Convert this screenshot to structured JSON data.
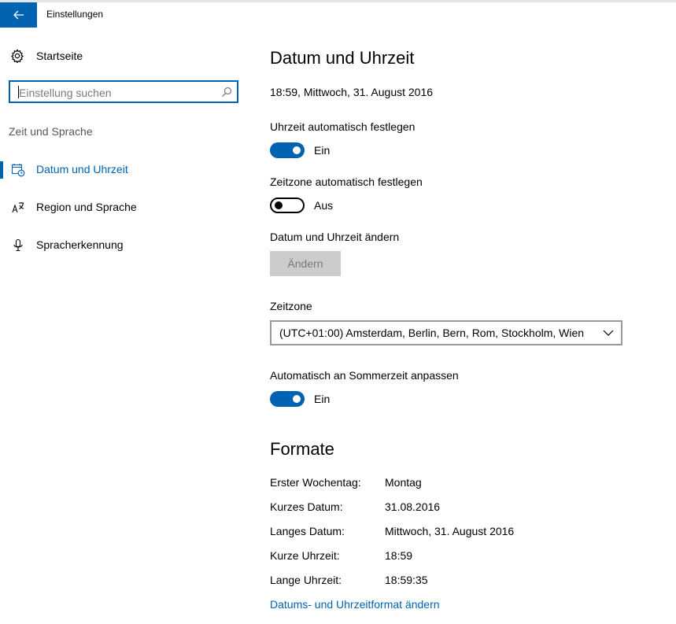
{
  "window": {
    "title": "Einstellungen"
  },
  "sidebar": {
    "home_label": "Startseite",
    "search": {
      "placeholder": "Einstellung suchen"
    },
    "section_label": "Zeit und Sprache",
    "items": [
      {
        "label": "Datum und Uhrzeit",
        "icon": "calendar-clock-icon",
        "active": true
      },
      {
        "label": "Region und Sprache",
        "icon": "language-icon",
        "active": false
      },
      {
        "label": "Spracherkennung",
        "icon": "microphone-icon",
        "active": false
      }
    ]
  },
  "main": {
    "title": "Datum und Uhrzeit",
    "current_datetime": "18:59, Mittwoch, 31. August 2016",
    "auto_time": {
      "label": "Uhrzeit automatisch festlegen",
      "state": "Ein",
      "on": true
    },
    "auto_timezone": {
      "label": "Zeitzone automatisch festlegen",
      "state": "Aus",
      "on": false
    },
    "change": {
      "label": "Datum und Uhrzeit ändern",
      "button": "Ändern"
    },
    "timezone": {
      "label": "Zeitzone",
      "value": "(UTC+01:00) Amsterdam, Berlin, Bern, Rom, Stockholm, Wien"
    },
    "dst": {
      "label": "Automatisch an Sommerzeit anpassen",
      "state": "Ein",
      "on": true
    },
    "formats": {
      "title": "Formate",
      "rows": [
        {
          "key": "Erster Wochentag:",
          "value": "Montag"
        },
        {
          "key": "Kurzes Datum:",
          "value": "31.08.2016"
        },
        {
          "key": "Langes Datum:",
          "value": "Mittwoch, 31. August 2016"
        },
        {
          "key": "Kurze Uhrzeit:",
          "value": "18:59"
        },
        {
          "key": "Lange Uhrzeit:",
          "value": "18:59:35"
        }
      ],
      "link": "Datums- und Uhrzeitformat ändern"
    }
  },
  "colors": {
    "accent": "#0063b1",
    "disabled_bg": "#cccccc",
    "disabled_text": "#7a7a7a"
  }
}
